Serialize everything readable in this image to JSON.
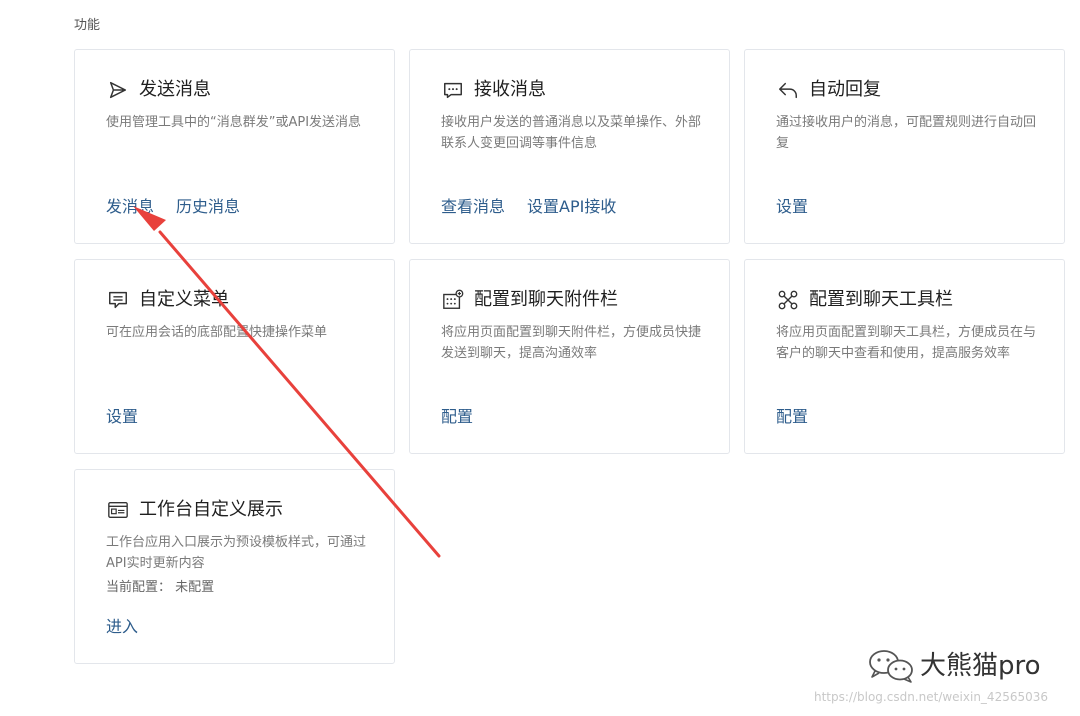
{
  "section": {
    "title": "功能"
  },
  "cards": [
    {
      "title": "发送消息",
      "icon": "send-icon",
      "description": "使用管理工具中的“消息群发”或API发送消息",
      "links": [
        "发消息",
        "历史消息"
      ]
    },
    {
      "title": "接收消息",
      "icon": "message-icon",
      "description": "接收用户发送的普通消息以及菜单操作、外部联系人变更回调等事件信息",
      "links": [
        "查看消息",
        "设置API接收"
      ]
    },
    {
      "title": "自动回复",
      "icon": "reply-icon",
      "description": "通过接收用户的消息，可配置规则进行自动回复",
      "links": [
        "设置"
      ]
    },
    {
      "title": "自定义菜单",
      "icon": "menu-icon",
      "description": "可在应用会话的底部配置快捷操作菜单",
      "links": [
        "设置"
      ]
    },
    {
      "title": "配置到聊天附件栏",
      "icon": "attachment-bar-icon",
      "description": "将应用页面配置到聊天附件栏，方便成员快捷发送到聊天，提高沟通效率",
      "links": [
        "配置"
      ]
    },
    {
      "title": "配置到聊天工具栏",
      "icon": "toolbar-icon",
      "description": "将应用页面配置到聊天工具栏，方便成员在与客户的聊天中查看和使用，提高服务效率",
      "links": [
        "配置"
      ]
    },
    {
      "title": "工作台自定义展示",
      "icon": "workbench-icon",
      "description": "工作台应用入口展示为预设模板样式，可通过API实时更新内容",
      "extra": "当前配置： 未配置",
      "links": [
        "进入"
      ]
    }
  ],
  "annotation": {
    "arrow_color": "#e8413c"
  },
  "watermark": {
    "text": "大熊猫pro",
    "icon": "wechat-icon",
    "url": "https://blog.csdn.net/weixin_42565036"
  },
  "colors": {
    "link": "#2e5d8c",
    "border": "#e3e6eb"
  }
}
